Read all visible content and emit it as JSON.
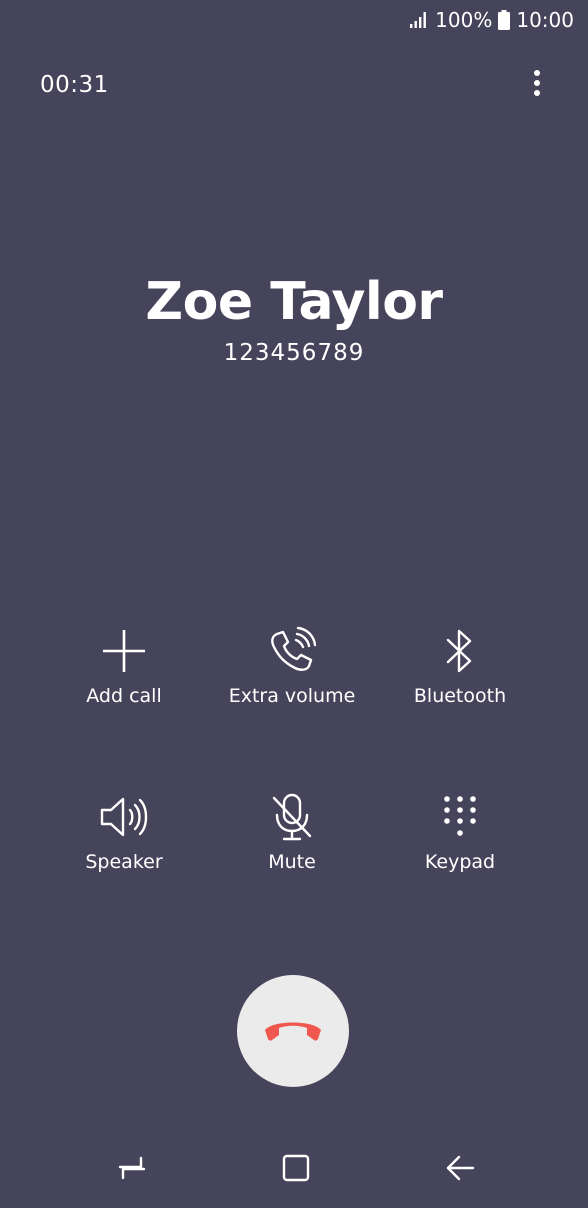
{
  "status_bar": {
    "battery": "100%",
    "time": "10:00",
    "icons": [
      "signal-icon",
      "battery-icon"
    ]
  },
  "call": {
    "duration": "00:31",
    "caller_name": "Zoe Taylor",
    "caller_number": "123456789"
  },
  "menu": {
    "icon": "more-vert-icon"
  },
  "actions": [
    {
      "label": "Add call",
      "icon": "plus-icon"
    },
    {
      "label": "Extra volume",
      "icon": "phone-volume-icon"
    },
    {
      "label": "Bluetooth",
      "icon": "bluetooth-icon"
    },
    {
      "label": "Speaker",
      "icon": "speaker-icon"
    },
    {
      "label": "Mute",
      "icon": "mic-off-icon"
    },
    {
      "label": "Keypad",
      "icon": "keypad-icon"
    }
  ],
  "end_call": {
    "icon": "end-call-icon",
    "color": "#f0574f"
  },
  "navbar": {
    "buttons": [
      "recents-icon",
      "home-icon",
      "back-icon"
    ]
  },
  "colors": {
    "background": "#46445a",
    "text": "#ffffff",
    "end_button_bg": "#ebebeb"
  }
}
